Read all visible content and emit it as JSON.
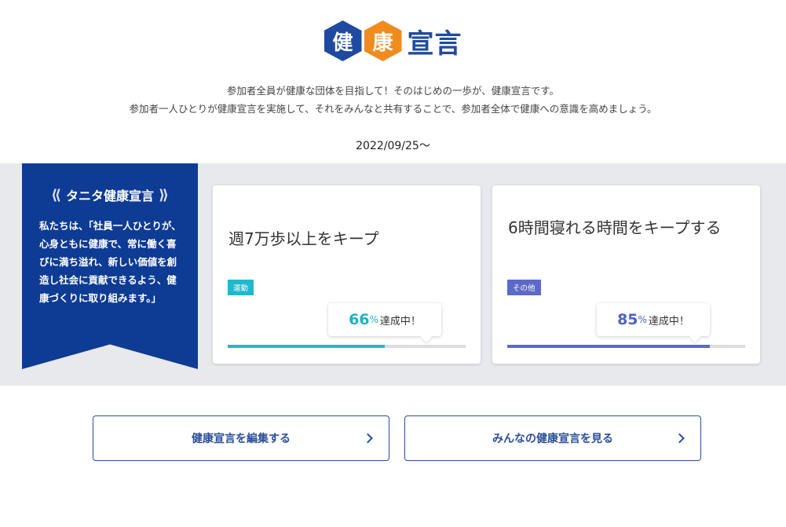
{
  "logo": {
    "char1": "健",
    "char2": "康",
    "rest": "宣言"
  },
  "intro": {
    "line1": "参加者全員が健康な団体を目指して！そのはじめの一歩が、健康宣言です。",
    "line2": "参加者一人ひとりが健康宣言を実施して、それをみんなと共有することで、参加者全体で健康への意識を高めましょう。"
  },
  "date": "2022/09/25〜",
  "declaration": {
    "title": "タニタ健康宣言",
    "body": "私たちは、「社員一人ひとりが、心身ともに健康で、常に働く喜びに満ち溢れ、新しい価値を創造し社会に貢献できるよう、健康づくりに取り組みます。」"
  },
  "goals": [
    {
      "text": "週7万歩以上をキープ",
      "tag": "運動",
      "percent": 66,
      "pct_unit": "%",
      "status": "達成中！",
      "color": "#22b8cc"
    },
    {
      "text": "6時間寝れる時間をキープする",
      "tag": "その他",
      "percent": 85,
      "pct_unit": "%",
      "status": "達成中！",
      "color": "#5c69c8"
    }
  ],
  "buttons": {
    "edit": "健康宣言を編集する",
    "view_all": "みんなの健康宣言を見る"
  }
}
